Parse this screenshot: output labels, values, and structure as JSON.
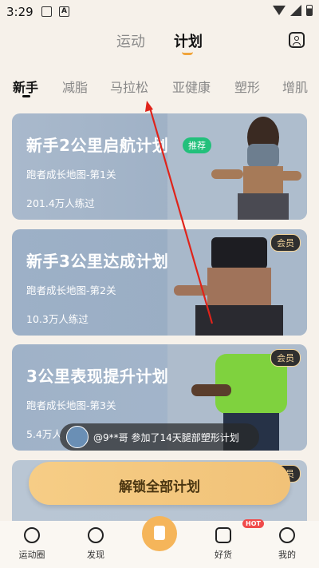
{
  "status_bar": {
    "time": "3:29"
  },
  "top_tabs": [
    {
      "label": "运动"
    },
    {
      "label": "计划"
    }
  ],
  "categories": [
    {
      "label": "新手"
    },
    {
      "label": "减脂"
    },
    {
      "label": "马拉松"
    },
    {
      "label": "亚健康"
    },
    {
      "label": "塑形"
    },
    {
      "label": "增肌"
    }
  ],
  "cards": [
    {
      "title": "新手2公里启航计划",
      "subtitle": "跑者成长地图-第1关",
      "count": "201.4万人练过",
      "badge": "推荐"
    },
    {
      "title": "新手3公里达成计划",
      "subtitle": "跑者成长地图-第2关",
      "count": "10.3万人练过",
      "badge": "会员"
    },
    {
      "title": "3公里表现提升计划",
      "subtitle": "跑者成长地图-第3关",
      "count": "5.4万人",
      "badge": "会员"
    },
    {
      "title": "",
      "subtitle": "",
      "count": "",
      "badge": "会员"
    }
  ],
  "toast": {
    "text": "@9**哥 参加了14天腿部塑形计划"
  },
  "unlock_button": {
    "label": "解锁全部计划"
  },
  "bottom_nav": [
    {
      "label": "运动圈"
    },
    {
      "label": "发现"
    },
    {
      "label": ""
    },
    {
      "label": "好货",
      "badge": "HOT"
    },
    {
      "label": "我的"
    }
  ],
  "colors": {
    "accent": "#f0a43b",
    "recommend": "#22c07b",
    "vip_text": "#f3d49a",
    "card_blue": "#9eb2c8"
  }
}
